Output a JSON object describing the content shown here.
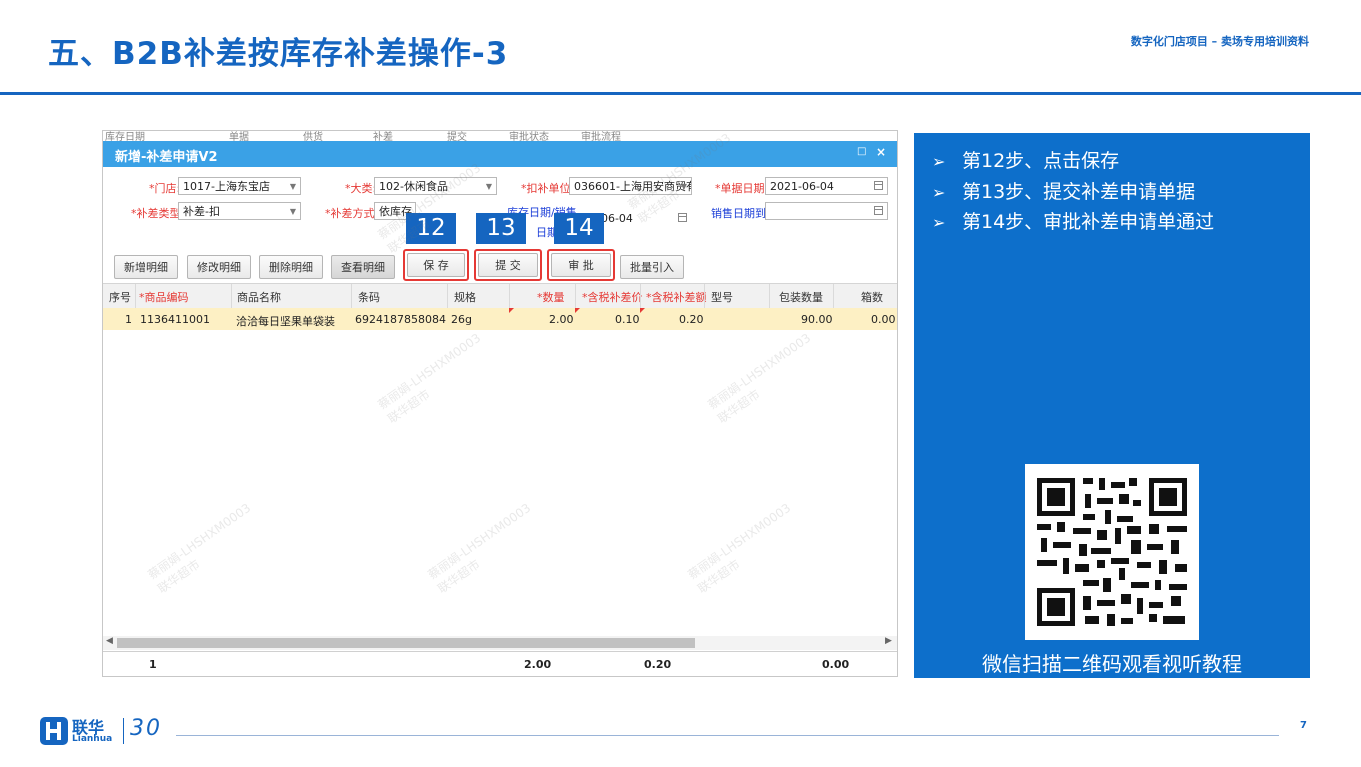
{
  "slide": {
    "title": "五、B2B补差按库存补差操作-3",
    "subtitle": "数字化门店项目 – 卖场专用培训资料",
    "page_number": "7"
  },
  "window": {
    "title": "新增-补差申请V2",
    "background_menu": [
      "库存日期",
      "单据",
      "供货",
      "补差",
      "提交",
      "审批状态",
      "审批流程"
    ],
    "controls": {
      "maximize": "□",
      "close": "×"
    }
  },
  "form": {
    "store_label": "*门店:",
    "store_value": "1017-上海东宝店",
    "category_label": "*大类:",
    "category_value": "102-休闲食品",
    "deduct_unit_label": "*扣补单位:",
    "deduct_unit_value": "036601-上海用安商贸有",
    "doc_date_label": "*单据日期:",
    "doc_date_value": "2021-06-04",
    "type_label": "*补差类型:",
    "type_value": "补差-扣",
    "method_label": "*补差方式:",
    "method_value": "依库存",
    "stock_date_label": "库存日期/销售",
    "stock_date_label2": "日期",
    "stock_date_value": "-06-04",
    "sales_date_to_label": "销售日期到:",
    "sales_date_to_value": ""
  },
  "buttons": {
    "add_detail": "新增明细",
    "edit_detail": "修改明细",
    "delete_detail": "删除明细",
    "view_detail": "查看明细",
    "save": "保 存",
    "submit": "提 交",
    "approve": "审 批",
    "batch_import": "批量引入"
  },
  "steps_badges": {
    "save": "12",
    "submit": "13",
    "approve": "14"
  },
  "grid": {
    "columns": [
      "序号",
      "*商品编码",
      "商品名称",
      "条码",
      "规格",
      "*数量",
      "*含税补差价",
      "*含税补差额",
      "型号",
      "包装数量",
      "箱数"
    ],
    "rows": [
      [
        "1",
        "1136411001",
        "洽洽每日坚果单袋装",
        "6924187858084",
        "26g",
        "2.00",
        "0.10",
        "0.20",
        "",
        "90.00",
        "0.00"
      ]
    ],
    "totals": {
      "count": "1",
      "quantity": "2.00",
      "amount": "0.20",
      "boxes": "0.00"
    }
  },
  "watermark": {
    "line1": "蔡丽娟-LHSHXM0003",
    "line2": "联华超市"
  },
  "panel": {
    "steps": [
      "第12步、点击保存",
      "第13步、提交补差申请单据",
      "第14步、审批补差申请单通过"
    ],
    "qr_caption": "微信扫描二维码观看视听教程"
  },
  "logo": {
    "brand_cn": "联华",
    "brand_en": "Lianhua",
    "anniversary": "30"
  },
  "colors": {
    "accent": "#1565c0",
    "panel": "#0d6fcb",
    "title_bar": "#3aa1e6",
    "highlight": "#e53935",
    "row_selected": "#fdf0c4"
  }
}
